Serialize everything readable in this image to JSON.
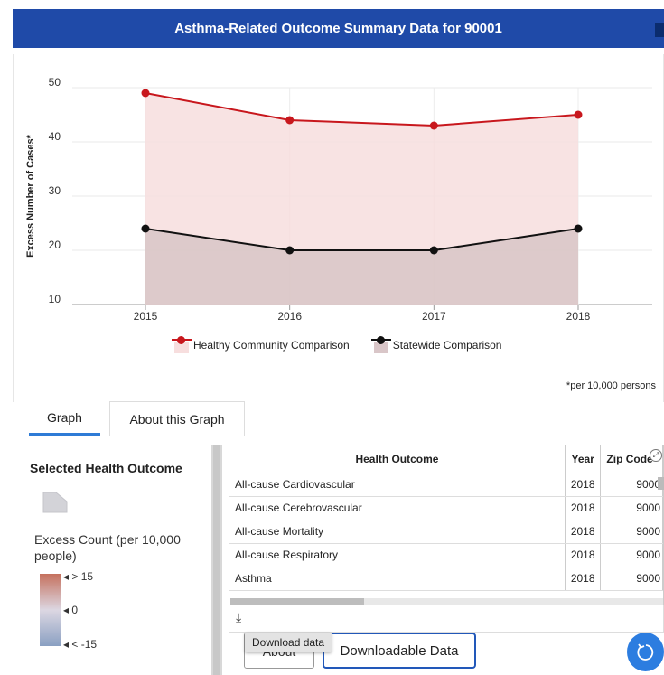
{
  "header": {
    "title": "Asthma-Related Outcome Summary Data for 90001"
  },
  "chart_data": {
    "type": "line",
    "x": [
      "2015",
      "2016",
      "2017",
      "2018"
    ],
    "series": [
      {
        "name": "Healthy Community Comparison",
        "values": [
          49,
          44,
          43,
          45
        ],
        "color": "#c8171d",
        "fill": "#f7dede"
      },
      {
        "name": "Statewide Comparison",
        "values": [
          24,
          20,
          20,
          24
        ],
        "color": "#111111",
        "fill": "#d9c6c8"
      }
    ],
    "xlabel": "",
    "ylabel": "Excess Number of Cases*",
    "ylim": [
      10,
      50
    ],
    "yticks": [
      10,
      20,
      30,
      40,
      50
    ],
    "grid": true,
    "legend": "bottom",
    "footnote": "*per 10,000 persons"
  },
  "tabs": [
    {
      "label": "Graph",
      "active": true
    },
    {
      "label": "About this Graph",
      "active": false
    }
  ],
  "left_panel": {
    "title": "Selected Health Outcome",
    "excess_label": "Excess Count (per 10,000 people)",
    "ticks": [
      "> 15",
      "0",
      "< -15"
    ]
  },
  "table": {
    "columns": [
      "Health Outcome",
      "Year",
      "Zip Code"
    ],
    "rows": [
      [
        "All-cause Cardiovascular",
        "2018",
        "9000"
      ],
      [
        "All-cause Cerebrovascular",
        "2018",
        "9000"
      ],
      [
        "All-cause Mortality",
        "2018",
        "9000"
      ],
      [
        "All-cause Respiratory",
        "2018",
        "9000"
      ],
      [
        "Asthma",
        "2018",
        "9000"
      ]
    ]
  },
  "buttons": {
    "about": "About",
    "downloadable_data": "Downloadable Data",
    "download_tooltip": "Download data"
  },
  "colors": {
    "header": "#1f4aa8",
    "accent": "#2e7bd6",
    "refresh": "#2c7de0"
  }
}
